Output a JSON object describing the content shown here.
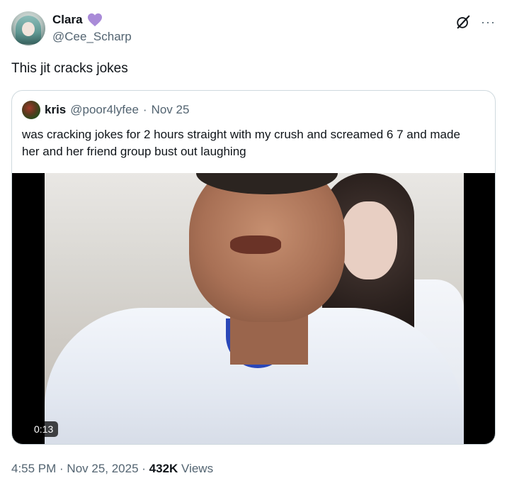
{
  "author": {
    "display_name": "Clara",
    "handle": "@Cee_Scharp",
    "badge_icon": "purple-heart-icon",
    "badge_color": "#9b7fd1"
  },
  "header_actions": {
    "grok_icon": "grok-icon",
    "more_label": "···"
  },
  "tweet": {
    "text": "This jit cracks jokes"
  },
  "quote": {
    "display_name": "kris",
    "handle": "@poor4lyfee",
    "separator": "·",
    "date": "Nov 25",
    "text": "was cracking jokes for 2 hours straight with my crush and screamed 6 7 and made her and her friend group bust out laughing",
    "video_duration": "0:13"
  },
  "meta": {
    "time": "4:55 PM",
    "sep1": " · ",
    "date": "Nov 25, 2025",
    "sep2": " · ",
    "views_count": "432K",
    "views_label": " Views"
  },
  "colors": {
    "text": "#0f1419",
    "muted": "#536471",
    "border": "#cfd9de"
  }
}
